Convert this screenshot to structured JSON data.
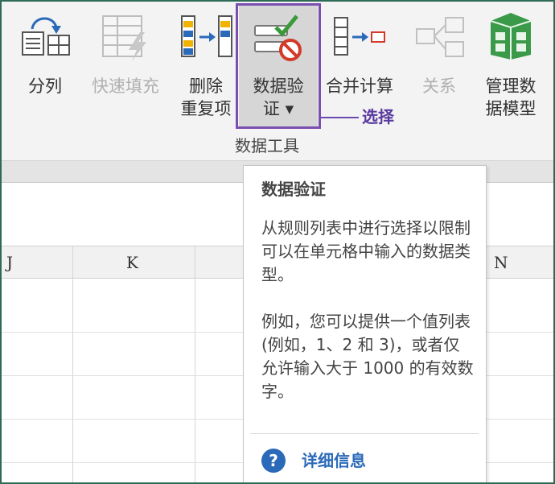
{
  "ribbon": {
    "buttons": [
      {
        "label": "分列"
      },
      {
        "label": "快速填充"
      },
      {
        "label": "删除",
        "label2": "重复项"
      },
      {
        "label": "数据验",
        "label2": "证 ▾"
      },
      {
        "label": "合并计算"
      },
      {
        "label": "关系"
      },
      {
        "label": "管理数",
        "label2": "据模型"
      }
    ],
    "group_label": "数据工具",
    "callout": "选择"
  },
  "sheet": {
    "columns": [
      "J",
      "K",
      "N"
    ]
  },
  "tooltip": {
    "title": "数据验证",
    "body1": "从规则列表中进行选择以限制可以在单元格中输入的数据类型。",
    "body2": "例如，您可以提供一个值列表(例如，1、2 和 3)，或者仅允许输入大于 1000 的有效数字。",
    "more_label": "详细信息",
    "help_icon": "?"
  },
  "colors": {
    "highlight": "#7a4fb0",
    "link": "#2a6ab8",
    "frame": "#2e6b55"
  }
}
